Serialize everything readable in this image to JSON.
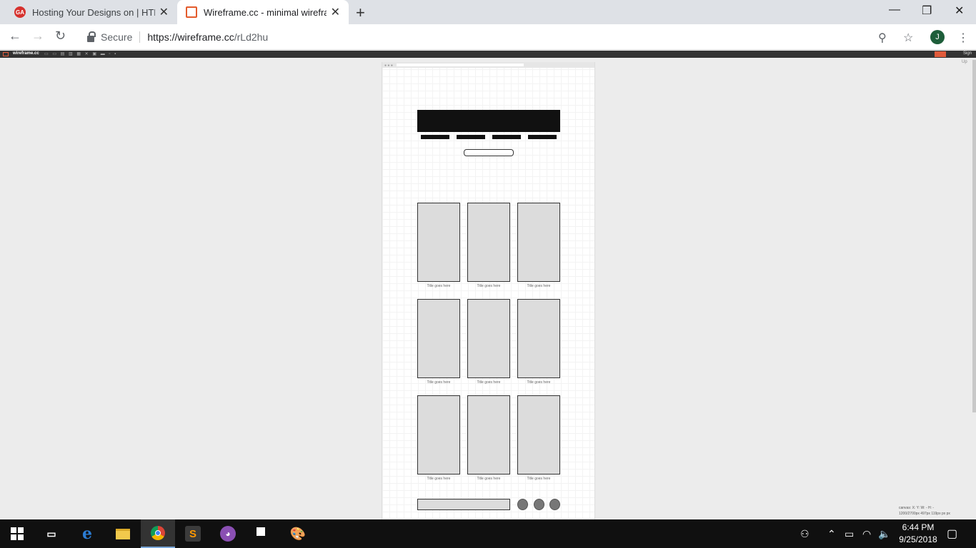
{
  "tabs": [
    {
      "title": "Hosting Your Designs on | HTML",
      "favicon": "ga-logo-icon",
      "active": false
    },
    {
      "title": "Wireframe.cc - minimal wirefram",
      "favicon": "wireframe-icon",
      "active": true
    }
  ],
  "address": {
    "secure_label": "Secure",
    "url_host": "https://wireframe.cc",
    "url_path": "/rLd2hu"
  },
  "profile_initial": "J",
  "app": {
    "logo": "wireframe.cc",
    "signup": "Up",
    "top_right": "Sign"
  },
  "wireframe": {
    "cards": [
      {
        "caption": "Title goes here"
      },
      {
        "caption": "Title goes here"
      },
      {
        "caption": "Title goes here"
      },
      {
        "caption": "Title goes here"
      },
      {
        "caption": "Title goes here"
      },
      {
        "caption": "Title goes here"
      },
      {
        "caption": "Title goes here"
      },
      {
        "caption": "Title goes here"
      },
      {
        "caption": "Title goes here"
      }
    ]
  },
  "status": {
    "line1": "canvas:   X:   Y:      W: -  H: -",
    "line2": "1200/2700px 497px 119px  px  px"
  },
  "taskbar": {
    "time": "6:44 PM",
    "date": "9/25/2018"
  },
  "colors": {
    "accent_red": "#e05a3a",
    "chrome_tab_bg": "#dee1e6",
    "taskbar": "#101010"
  }
}
